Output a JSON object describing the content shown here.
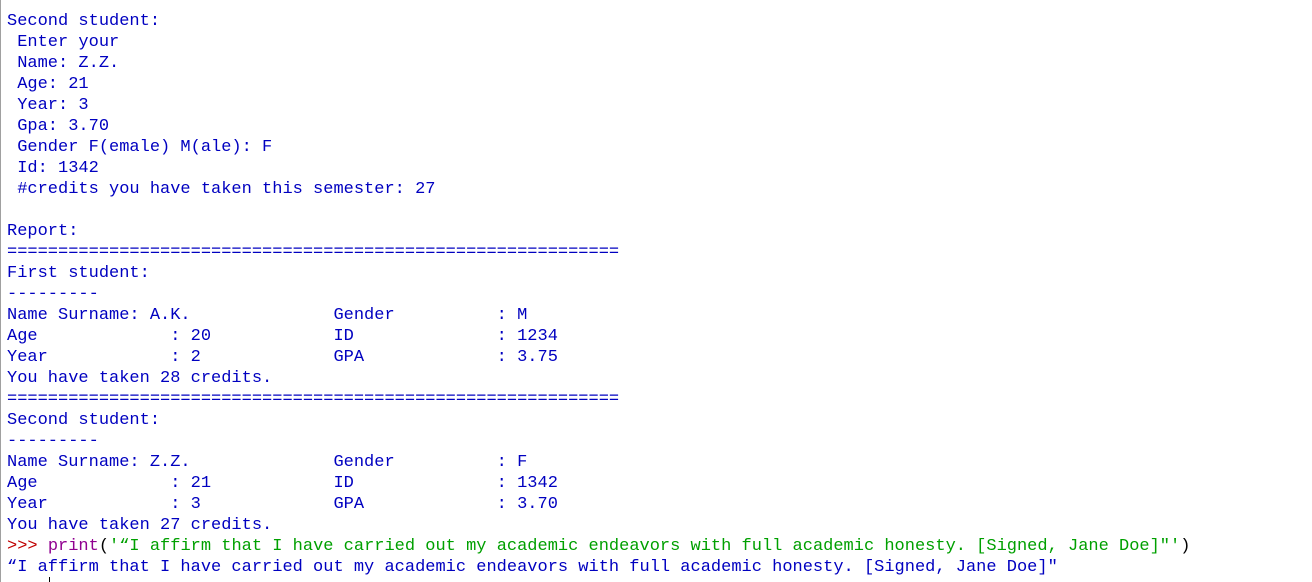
{
  "shell_output": {
    "lines": [
      "Second student:",
      " Enter your",
      " Name: Z.Z.",
      " Age: 21",
      " Year: 3",
      " Gpa: 3.70",
      " Gender F(emale) M(ale): F",
      " Id: 1342",
      " #credits you have taken this semester: 27",
      "",
      "Report:",
      "============================================================",
      "First student:",
      "---------",
      "Name Surname: A.K.              Gender          : M",
      "Age             : 20            ID              : 1234",
      "Year            : 2             GPA             : 3.75",
      "You have taken 28 credits.",
      "============================================================",
      "Second student:",
      "---------",
      "Name Surname: Z.Z.              Gender          : F",
      "Age             : 21            ID              : 1342",
      "Year            : 3             GPA             : 3.70",
      "You have taken 27 credits."
    ],
    "command": {
      "prompt": ">>> ",
      "function": "print",
      "open_paren": "(",
      "argument": "'“I affirm that I have carried out my academic endeavors with full academic honesty. [Signed, Jane Doe]\"'",
      "close_paren": ")"
    },
    "result": "“I affirm that I have carried out my academic endeavors with full academic honesty. [Signed, Jane Doe]\""
  },
  "colors": {
    "output_text": "#0000c0",
    "prompt": "#c00000",
    "builtin": "#900090",
    "string": "#00a000",
    "background": "#ffffff"
  }
}
